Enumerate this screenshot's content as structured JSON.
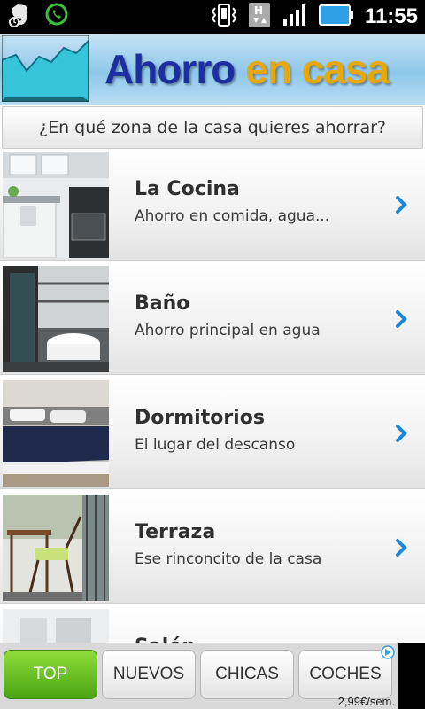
{
  "status_bar": {
    "time": "11:55",
    "icons": [
      "evernote-icon",
      "whatsapp-icon",
      "vibrate-icon",
      "hspa-icon",
      "signal-icon",
      "battery-icon"
    ]
  },
  "header": {
    "title_part1": "Ahorro",
    "title_part2": "en casa"
  },
  "question": "¿En qué zona de la casa quieres ahorrar?",
  "rooms": [
    {
      "title": "La Cocina",
      "subtitle": "Ahorro en comida, agua..."
    },
    {
      "title": "Baño",
      "subtitle": "Ahorro principal en agua"
    },
    {
      "title": "Dormitorios",
      "subtitle": "El lugar del descanso"
    },
    {
      "title": "Terraza",
      "subtitle": "Ese rinconcito de la casa"
    },
    {
      "title": "Salón",
      "subtitle": ""
    }
  ],
  "ad": {
    "tabs": [
      "TOP",
      "NUEVOS",
      "CHICAS",
      "COCHES"
    ],
    "active_tab": "TOP",
    "price": "2,99€/sem."
  },
  "colors": {
    "chevron": "#1e88d8",
    "active_tab": "#5cb51c",
    "title_blue": "#1b2fa0",
    "title_orange": "#e6a80c"
  }
}
